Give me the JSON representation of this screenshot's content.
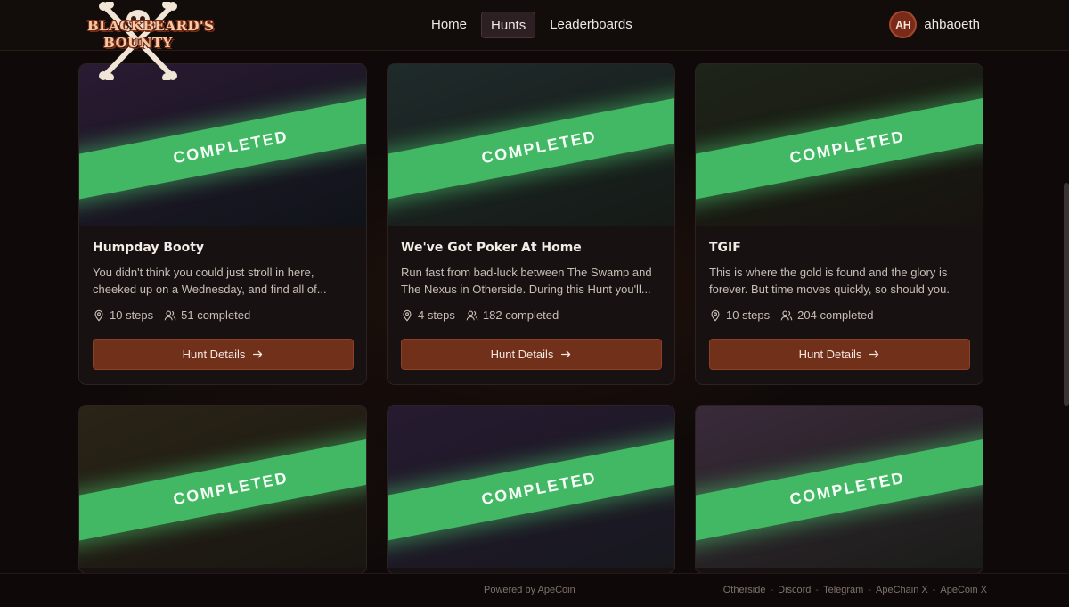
{
  "brand": {
    "logo_line1": "BLACKBEARD'S",
    "logo_line2": "BOUNTY"
  },
  "nav": {
    "items": [
      {
        "label": "Home",
        "active": false
      },
      {
        "label": "Hunts",
        "active": true
      },
      {
        "label": "Leaderboards",
        "active": false
      }
    ]
  },
  "user": {
    "initials": "AH",
    "name": "ahbaoeth"
  },
  "ribbon_label": "COMPLETED",
  "cards": [
    {
      "title": "Humpday Booty",
      "description": "You didn't think you could just stroll in here, cheeked up on a Wednesday, and find all of...",
      "steps": "10 steps",
      "completed": "51 completed",
      "button": "Hunt Details",
      "tint": [
        "#2a1a33",
        "#0f1418"
      ]
    },
    {
      "title": "We've Got Poker At Home",
      "description": "Run fast from bad-luck between The Swamp and The Nexus in Otherside. During this Hunt you'll...",
      "steps": "4 steps",
      "completed": "182 completed",
      "button": "Hunt Details",
      "tint": [
        "#1f2a2a",
        "#151a16"
      ]
    },
    {
      "title": "TGIF",
      "description": "This is where the gold is found and the glory is forever. But time moves quickly, so should you.",
      "steps": "10 steps",
      "completed": "204 completed",
      "button": "Hunt Details",
      "tint": [
        "#1d2418",
        "#17130f"
      ]
    },
    {
      "tint": [
        "#2a2416",
        "#191612"
      ]
    },
    {
      "tint": [
        "#261a30",
        "#17181e"
      ]
    },
    {
      "tint": [
        "#3a2a3a",
        "#1a1c18"
      ]
    }
  ],
  "footer": {
    "powered": "Powered by ApeCoin",
    "links": [
      "Otherside",
      "Discord",
      "Telegram",
      "ApeChain X",
      "ApeCoin X"
    ]
  },
  "colors": {
    "accent": "#70301a",
    "ribbon": "#43b864",
    "background": "#0f0a09"
  }
}
